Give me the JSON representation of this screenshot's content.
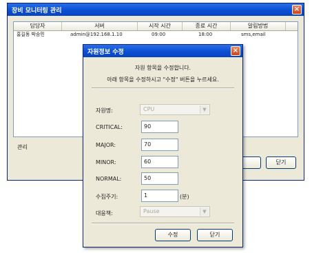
{
  "main_window": {
    "title": "장비 모니터링 관리",
    "close_icon": "close-icon",
    "columns": [
      "담당자",
      "서버",
      "시작 시간",
      "종료 시간",
      "알림방법"
    ],
    "rows": [
      [
        "홍길동 박승민",
        "admin@192.168.1.10",
        "09:00",
        "18:00",
        "sms,email"
      ]
    ],
    "status_label": "관리",
    "buttons": {
      "partial": "",
      "close": "닫기"
    }
  },
  "dialog": {
    "title": "자원정보 수정",
    "close_icon": "close-icon",
    "message_line1": "자원 항목을 수정합니다.",
    "message_line2": "아래 항목을 수정하시고 \"수정\" 버튼을 누르세요.",
    "fields": {
      "resource_type": {
        "label": "자원명:",
        "value": "CPU"
      },
      "critical": {
        "label": "CRITICAL:",
        "value": "90"
      },
      "major": {
        "label": "MAJOR:",
        "value": "70"
      },
      "minor": {
        "label": "MINOR:",
        "value": "60"
      },
      "normal": {
        "label": "NORMAL:",
        "value": "50"
      },
      "interval": {
        "label": "수집주기:",
        "value": "1",
        "unit": "(분)"
      },
      "method": {
        "label": "대응책:",
        "value": "Pause"
      }
    },
    "buttons": {
      "modify": "수정",
      "close": "닫기"
    }
  }
}
